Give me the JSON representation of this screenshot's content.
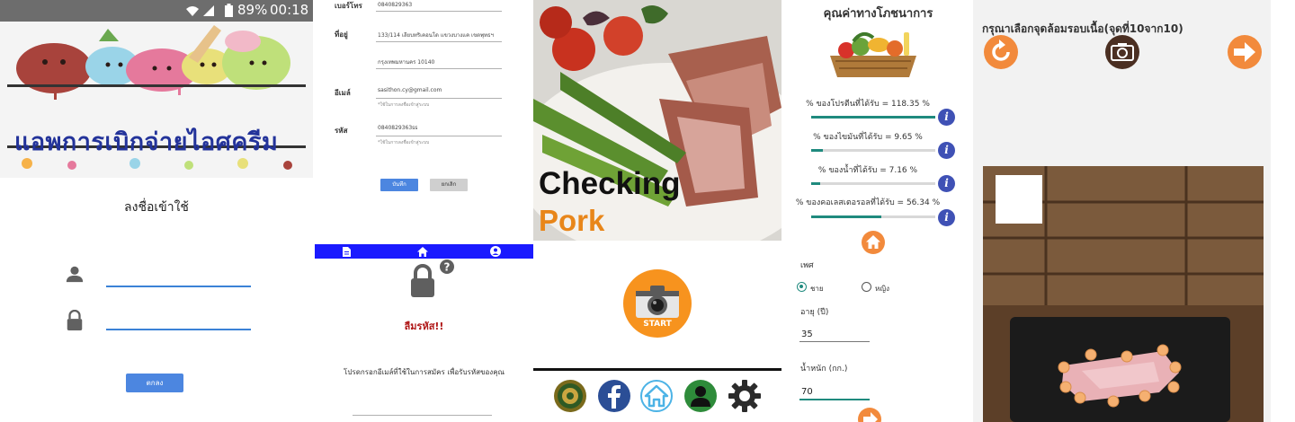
{
  "login_screen": {
    "status_bar": {
      "battery": "89%",
      "time": "00:18"
    },
    "banner_title": "แอพการเบิกจ่ายไอศครีม",
    "title": "ลงชื่อเข้าใช้",
    "login_button": "ตกลง",
    "icons": [
      "person-icon",
      "lock-icon"
    ]
  },
  "profile_form": {
    "fields": [
      {
        "label": "เบอร์โทร",
        "value": "0840829363"
      },
      {
        "label": "ที่อยู่",
        "value": "133/114 เลียบทริเคอนโด แขวงบางแค เขตพุทธฯ"
      },
      {
        "label": "",
        "value": "กรุงเทพมหานคร 10140"
      },
      {
        "label": "อีเมล์",
        "value": "sasithon.cy@gmail.com",
        "hint": "*ใช้ในการลงชื่อเข้าสู่ระบบ"
      },
      {
        "label": "รหัส",
        "value": "0840829363ss",
        "hint": "*ใช้ในการลงชื่อเข้าสู่ระบบ"
      }
    ],
    "save_button": "บันทึก",
    "cancel_button": "ยกเลิก",
    "nav_icons": [
      "document-icon",
      "home-icon",
      "account-icon"
    ]
  },
  "forgot_screen": {
    "title": "ลืมรหัส!!",
    "description": "โปรดกรอกอีเมล์ที่ใช้ในการสมัคร เพื่อรับรหัสของคุณ"
  },
  "checking_pork": {
    "title_line1": "Checking",
    "title_line2": "Pork",
    "start_label": "START",
    "bottom_icons": [
      "emblem-icon",
      "facebook-icon",
      "home-icon",
      "profile-icon",
      "settings-icon"
    ],
    "colors": {
      "accent": "#f7931e",
      "facebook": "#2b4e96",
      "home": "#4cb3e6",
      "profile": "#2e8b3a"
    }
  },
  "nutrition": {
    "title": "คุณค่าทางโภชนาการ",
    "stats": [
      {
        "label": "% ของโปรตีนที่ได้รับ = 118.35 %",
        "percent": 100
      },
      {
        "label": "% ของไขมันที่ได้รับ = 9.65 %",
        "percent": 9.65
      },
      {
        "label": "% ของน้ำที่ได้รับ = 7.16 %",
        "percent": 7.16
      },
      {
        "label": "% ของคอเลสเตอรอลที่ได้รับ = 56.34 %",
        "percent": 56.34
      }
    ],
    "gender_label": "เพศ",
    "gender_options": [
      {
        "label": "ชาย",
        "selected": true
      },
      {
        "label": "หญิง",
        "selected": false
      }
    ],
    "age_label": "อายุ (ปี)",
    "age_value": "35",
    "weight_label": "น้ำหนัก (กก.)",
    "weight_value": "70",
    "accent": "#1f8a7e"
  },
  "point_select": {
    "title": "กรุณาเลือกจุดล้อมรอบเนื้อ(จุดที่10จาก10)",
    "icons": [
      "refresh-icon",
      "camera-icon",
      "next-arrow-icon"
    ],
    "selected_points": 10,
    "total_points": 10,
    "accent": "#f28a3c"
  }
}
